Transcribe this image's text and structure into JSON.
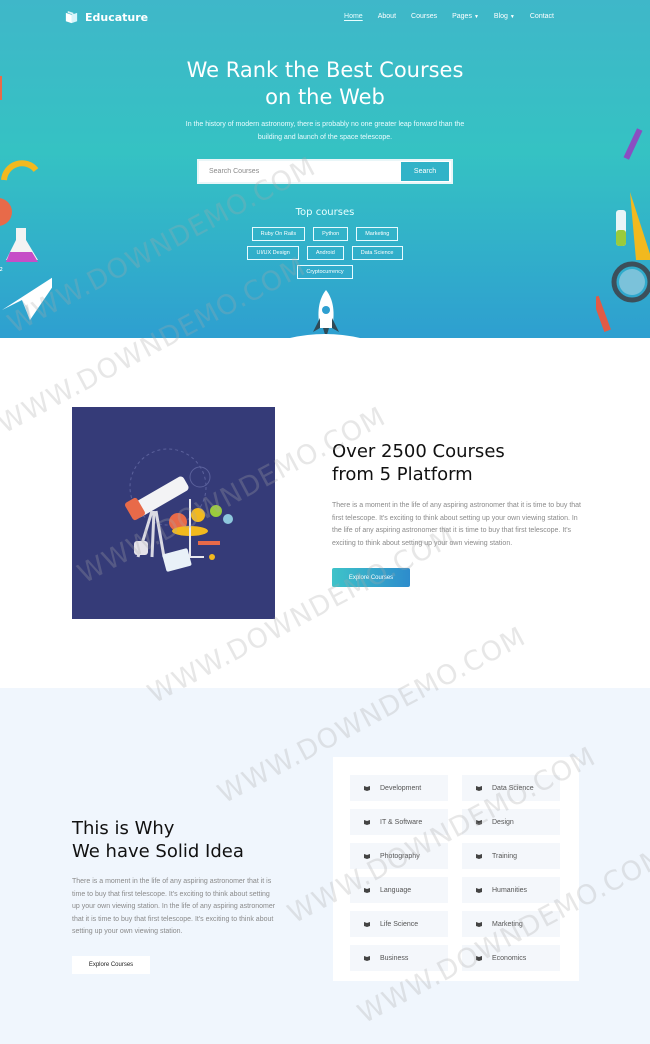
{
  "nav": {
    "logo_text": "Educature",
    "menu": [
      {
        "label": "Home"
      },
      {
        "label": "About"
      },
      {
        "label": "Courses"
      },
      {
        "label": "Pages"
      },
      {
        "label": "Blog"
      },
      {
        "label": "Contact"
      }
    ]
  },
  "hero": {
    "title_line1": "We Rank the Best Courses",
    "title_line2": "on the Web",
    "subtitle": "In the history of modern astronomy, there is probably no one greater leap forward than the building and launch of the space telescope.",
    "search_placeholder": "Search Courses",
    "search_button": "Search",
    "top_courses_title": "Top courses",
    "tags": [
      "Ruby On Rails",
      "Python",
      "Marketing",
      "UI/UX Design",
      "Android",
      "Data Science",
      "Cryptocurrency"
    ]
  },
  "section_courses": {
    "title_line1": "Over 2500 Courses",
    "title_line2": "from 5 Platform",
    "text": "There is a moment in the life of any aspiring astronomer that it is time to buy that first telescope. It's exciting to think about setting up your own viewing station. In the life of any aspiring astronomer that it is time to buy that first telescope. It's exciting to think about setting up your own viewing station.",
    "button": "Explore Courses"
  },
  "section_idea": {
    "title_line1": "This is Why",
    "title_line2": "We have Solid Idea",
    "text": "There is a moment in the life of any aspiring astronomer that it is time to buy that first telescope. It's exciting to think about setting up your own viewing station. In the life of any aspiring astronomer that it is time to buy that first telescope. It's exciting to think about setting up your own viewing station.",
    "button": "Explore Courses",
    "categories": [
      "Development",
      "Data Science",
      "IT & Software",
      "Design",
      "Photography",
      "Training",
      "Language",
      "Humanities",
      "Life Science",
      "Marketing",
      "Business",
      "Economics"
    ]
  },
  "watermark": "WWW.DOWNDEMO.COM",
  "colors": {
    "hero_top": "#3fb7c9",
    "hero_bottom": "#2e9fd0",
    "accent": "#31b3c8",
    "image_bg": "#353b78",
    "section_bg": "#f0f6fd"
  }
}
